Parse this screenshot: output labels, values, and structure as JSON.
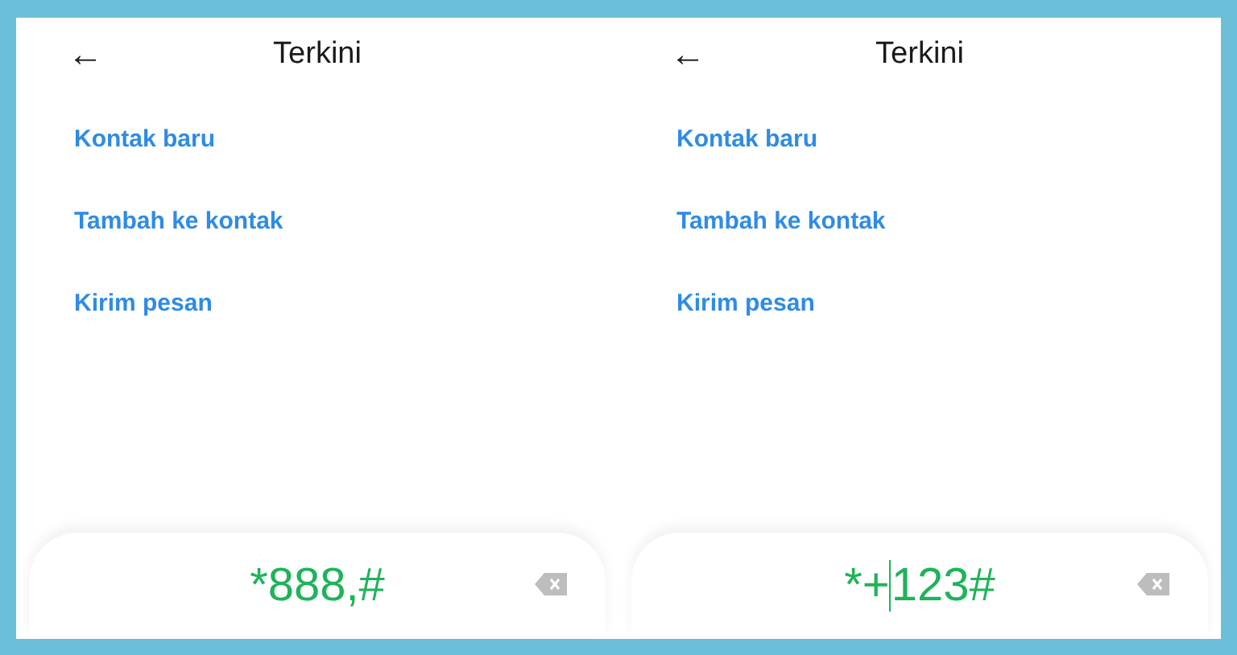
{
  "panels": [
    {
      "header": {
        "back": "←",
        "title": "Terkini"
      },
      "actions": [
        "Kontak baru",
        "Tambah ke kontak",
        "Kirim pesan"
      ],
      "dial": {
        "segments": [
          "*888,#"
        ]
      }
    },
    {
      "header": {
        "back": "←",
        "title": "Terkini"
      },
      "actions": [
        "Kontak baru",
        "Tambah ke kontak",
        "Kirim pesan"
      ],
      "dial": {
        "segments": [
          "*+",
          "123#"
        ]
      }
    }
  ]
}
